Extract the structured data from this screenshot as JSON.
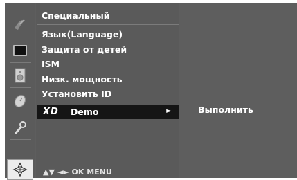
{
  "menu": {
    "title": "Специальный",
    "items": [
      "Язык(Language)",
      "Защита от детей",
      "ISM",
      "Низк. мощность",
      "Установить ID"
    ],
    "selected": {
      "logo": "XD",
      "label": "Demo",
      "arrow": "►"
    },
    "hints": "▲▼  ◄►  OK  MENU"
  },
  "submenu": {
    "label": "Выполнить"
  },
  "sidebar": {
    "icons": [
      "satellite-dish-icon",
      "screen-icon",
      "speaker-icon",
      "clock-icon",
      "wrench-icon",
      "option-cross-icon"
    ],
    "selected_index": 5
  },
  "colors": {
    "osd_background": "#5e5e5e",
    "selection_bar": "#151515",
    "text": "#ffffff"
  }
}
